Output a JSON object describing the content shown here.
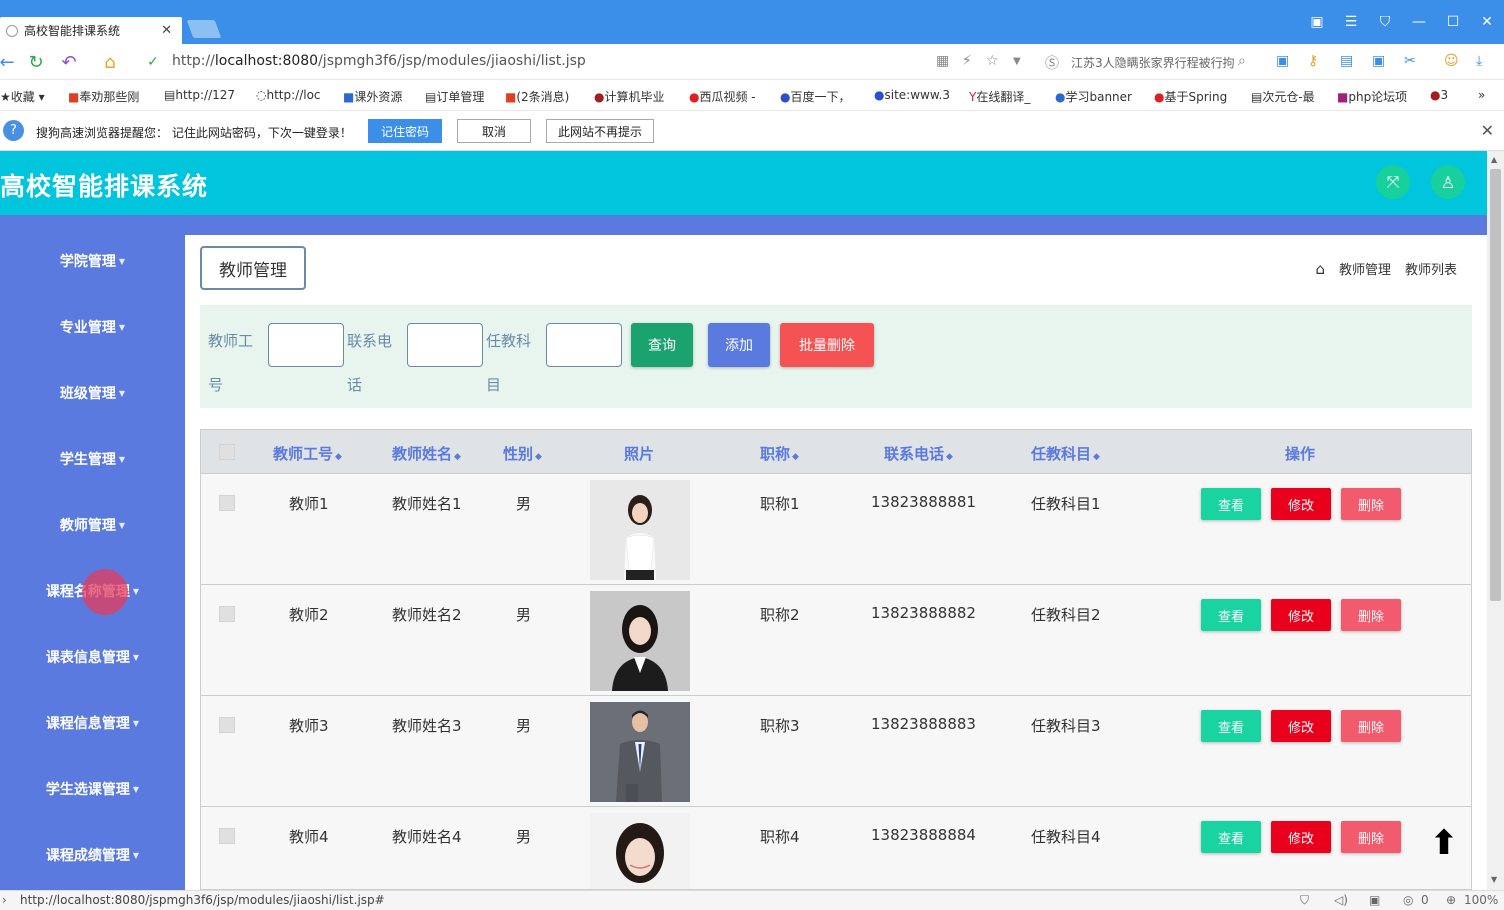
{
  "browser": {
    "tab_title": "高校智能排课系统",
    "url_prefix": "http://",
    "url_host": "localhost:8080",
    "url_path": "/jspmgh3f6/jsp/modules/jiaoshi/list.jsp",
    "search_text": "江苏3人隐瞒张家界行程被行拘",
    "bookmarks": [
      "收藏",
      "奉劝那些刚",
      "http://127",
      "http://loc",
      "课外资源",
      "订单管理",
      "(2条消息)",
      "计算机毕业",
      "西瓜视频 -",
      "百度一下，",
      "site:www.3",
      "在线翻译_",
      "学习banner",
      "基于Spring",
      "次元仓-最",
      "php论坛项",
      "3"
    ],
    "status_url": "http://localhost:8080/jspmgh3f6/jsp/modules/jiaoshi/list.jsp#",
    "zoom": "100%",
    "download_count": "0"
  },
  "password_bar": {
    "message": "搜狗高速浏览器提醒您： 记住此网站密码，下次一键登录！",
    "remember_label": "记住密码",
    "cancel_label": "取消",
    "never_label": "此网站不再提示"
  },
  "app": {
    "title": "高校智能排课系统"
  },
  "sidebar": {
    "items": [
      {
        "label": "学院管理"
      },
      {
        "label": "专业管理"
      },
      {
        "label": "班级管理"
      },
      {
        "label": "学生管理"
      },
      {
        "label": "教师管理"
      },
      {
        "label": "课程名称管理"
      },
      {
        "label": "课表信息管理"
      },
      {
        "label": "课程信息管理"
      },
      {
        "label": "学生选课管理"
      },
      {
        "label": "课程成绩管理"
      }
    ]
  },
  "page": {
    "heading": "教师管理",
    "breadcrumb": [
      "教师管理",
      "教师列表"
    ]
  },
  "filters": {
    "fields": [
      {
        "label": "教师工号",
        "value": ""
      },
      {
        "label": "联系电话",
        "value": ""
      },
      {
        "label": "任教科目",
        "value": ""
      }
    ],
    "query_label": "查询",
    "add_label": "添加",
    "batch_delete_label": "批量删除"
  },
  "table": {
    "headers": {
      "id": "教师工号",
      "name": "教师姓名",
      "gender": "性别",
      "photo": "照片",
      "title": "职称",
      "phone": "联系电话",
      "subject": "任教科目",
      "actions": "操作"
    },
    "actions": {
      "view": "查看",
      "edit": "修改",
      "delete": "删除"
    },
    "rows": [
      {
        "id": "教师1",
        "name": "教师姓名1",
        "gender": "男",
        "title": "职称1",
        "phone": "13823888881",
        "subject": "任教科目1"
      },
      {
        "id": "教师2",
        "name": "教师姓名2",
        "gender": "男",
        "title": "职称2",
        "phone": "13823888882",
        "subject": "任教科目2"
      },
      {
        "id": "教师3",
        "name": "教师姓名3",
        "gender": "男",
        "title": "职称3",
        "phone": "13823888883",
        "subject": "任教科目3"
      },
      {
        "id": "教师4",
        "name": "教师姓名4",
        "gender": "男",
        "title": "职称4",
        "phone": "13823888884",
        "subject": "任教科目4"
      }
    ]
  },
  "colors": {
    "header": "#00c5dc",
    "sidebar": "#5a7ae0",
    "filter_bg": "#e8f5ef",
    "query": "#1aa36e",
    "add": "#5a7ae0",
    "batch_delete": "#f55353",
    "view": "#19d3a0",
    "edit": "#e8001c",
    "delete": "#f25a6e"
  }
}
